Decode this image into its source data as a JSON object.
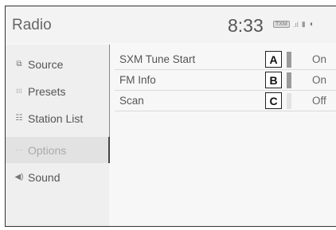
{
  "header": {
    "title": "Radio",
    "clock": "8:33",
    "status_badge": "TXM"
  },
  "sidebar": {
    "items": [
      {
        "label": "Source",
        "icon": "source-icon",
        "glyph": "⧉"
      },
      {
        "label": "Presets",
        "icon": "presets-icon",
        "glyph": "⋮⋮⋮"
      },
      {
        "label": "Station List",
        "icon": "station-list-icon",
        "glyph": "☷"
      },
      {
        "label": "Options",
        "icon": "options-icon",
        "glyph": "···"
      },
      {
        "label": "Sound",
        "icon": "sound-icon",
        "glyph": "◀)"
      }
    ],
    "selected": "Options"
  },
  "options": [
    {
      "label": "SXM Tune Start",
      "callout": "A",
      "value": "On",
      "indicator_color": "#9a9a9a"
    },
    {
      "label": "FM Info",
      "callout": "B",
      "value": "On",
      "indicator_color": "#9a9a9a"
    },
    {
      "label": "Scan",
      "callout": "C",
      "value": "Off",
      "indicator_color": "#e2e2e2"
    }
  ]
}
